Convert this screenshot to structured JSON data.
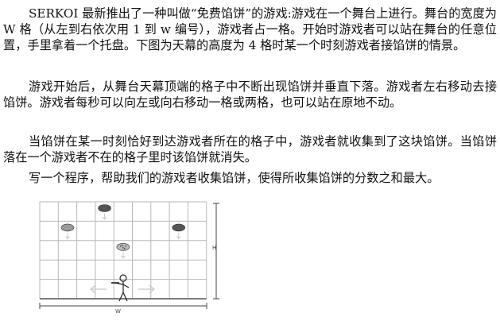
{
  "problem": {
    "para1": "SERKOI 最新推出了一种叫做“免费馅饼”的游戏:游戏在一个舞台上进行。舞台的宽度为 W 格（从左到右依次用 1 到 w 编号），游戏者占一格。开始时游戏者可以站在舞台的任意位置，手里拿着一个托盘。下图为天幕的高度为 4 格时某一个时刻游戏者接馅饼的情景。",
    "para2": "游戏开始后，从舞台天幕顶端的格子中不断出现馅饼并垂直下落。游戏者左右移动去接馅饼。游戏者每秒可以向左或向右移动一格或两格，也可以站在原地不动。",
    "para3": "当馅饼在某一时刻恰好到达游戏者所在的格子中，游戏者就收集到了这块馅饼。当馅饼落在一个游戏者不在的格子里时该馅饼就消失。",
    "para4": "写一个程序，帮助我们的游戏者收集馅饼，使得所收集馅饼的分数之和最大。"
  },
  "figure": {
    "height_label": "H",
    "width_label": "W",
    "grid_cols": 9,
    "grid_rows": 5,
    "pies": [
      {
        "col": 3,
        "row": 0,
        "shade": "dark"
      },
      {
        "col": 1,
        "row": 1,
        "shade": "light"
      },
      {
        "col": 7,
        "row": 1,
        "shade": "dark"
      },
      {
        "col": 4,
        "row": 2,
        "shade": "dots"
      }
    ],
    "colors": {
      "grid": "#b8b8b8",
      "pie_dark": "#555555",
      "pie_light": "#9a9a9a",
      "arrow": "#c8c8c8"
    }
  }
}
